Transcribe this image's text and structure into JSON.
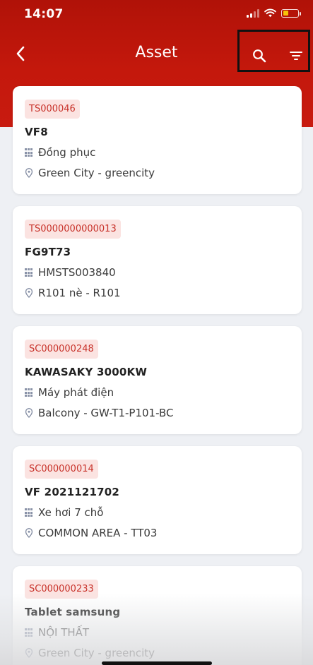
{
  "status_bar": {
    "time": "14:07"
  },
  "header": {
    "title": "Asset"
  },
  "assets": [
    {
      "code": "TS000046",
      "name": "VF8",
      "category": "Đồng phục",
      "location": "Green City - greencity"
    },
    {
      "code": "TS0000000000013",
      "name": "FG9T73",
      "category": "HMSTS003840",
      "location": "R101 nè - R101"
    },
    {
      "code": "SC000000248",
      "name": "KAWASAKY 3000KW",
      "category": "Máy phát điện",
      "location": "Balcony - GW-T1-P101-BC"
    },
    {
      "code": "SC000000014",
      "name": "VF 2021121702",
      "category": "Xe hơi 7 chỗ",
      "location": "COMMON AREA - TT03"
    },
    {
      "code": "SC000000233",
      "name": "Tablet samsung",
      "category": "NỘI THẤT",
      "location": "Green City - greencity"
    }
  ],
  "icons": {
    "back": "chevron-left-icon",
    "search": "search-icon",
    "filter": "filter-icon",
    "category": "grid-icon",
    "location": "location-pin-icon"
  },
  "colors": {
    "header_red": "#c4180c",
    "badge_bg": "#fbe3e1",
    "badge_text": "#c8322a"
  }
}
